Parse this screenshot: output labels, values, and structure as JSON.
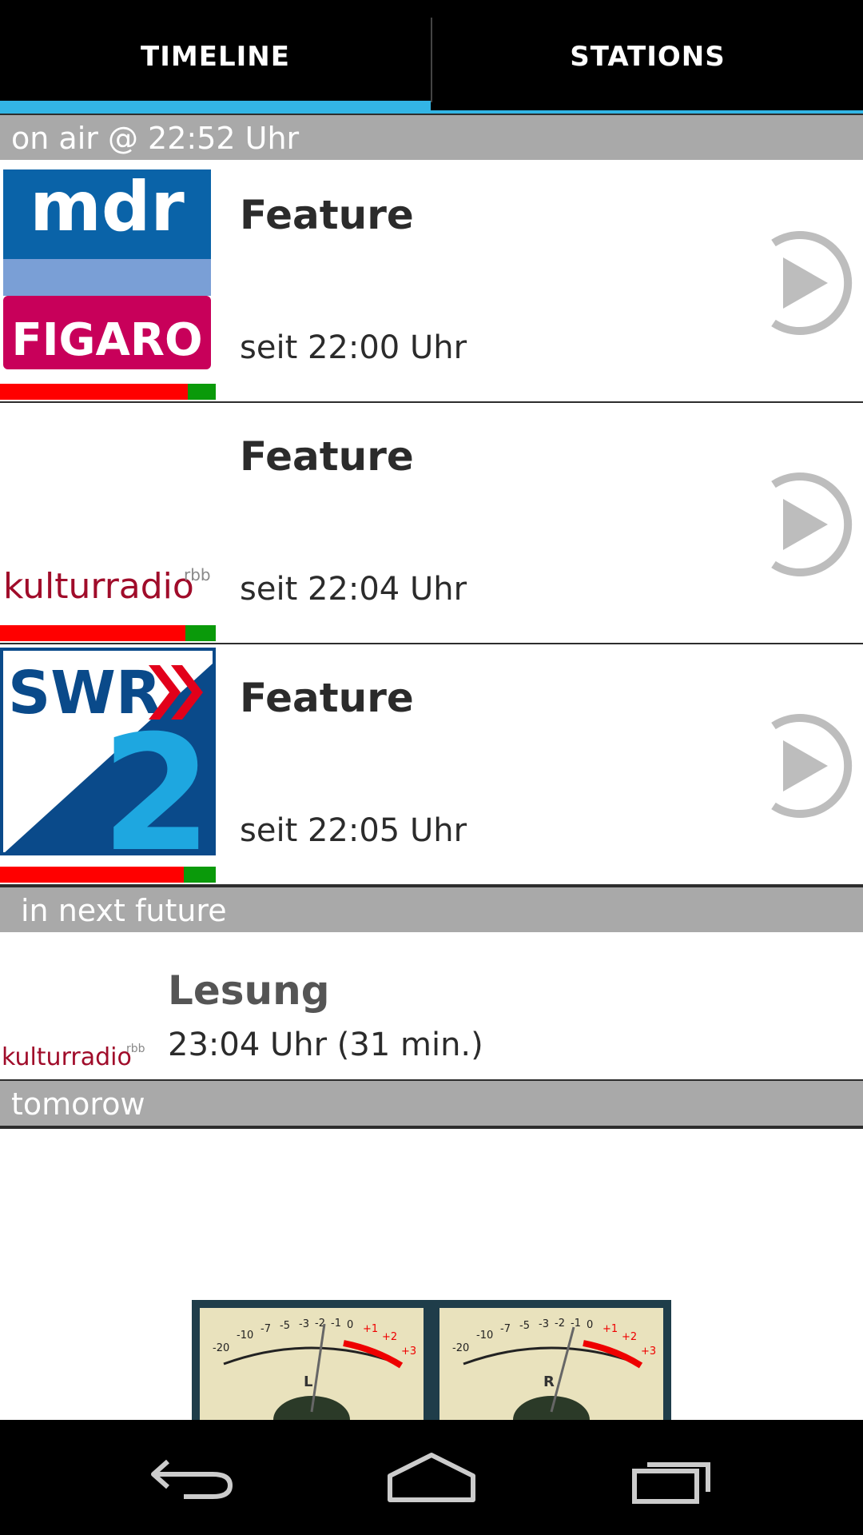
{
  "tabs": {
    "timeline": "TIMELINE",
    "stations": "STATIONS"
  },
  "sections": {
    "on_air": "on air @ 22:52 Uhr",
    "next_future": "in next future",
    "tomorrow": "tomorow"
  },
  "on_air_items": [
    {
      "station": "mdr FIGARO",
      "logo_top": "mdr",
      "logo_bottom": "FIGARO",
      "title": "Feature",
      "time": "seit 22:00 Uhr",
      "progress": 0.13
    },
    {
      "station": "kulturradio rbb",
      "logo_main": "kulturradio",
      "logo_sup": "rbb",
      "title": "Feature",
      "time": "seit 22:04 Uhr",
      "progress": 0.14
    },
    {
      "station": "SWR2",
      "logo_main": "SWR",
      "logo_num": "2",
      "title": "Feature",
      "time": "seit 22:05 Uhr",
      "progress": 0.15
    }
  ],
  "future_items": [
    {
      "station": "kulturradio rbb",
      "logo_main": "kulturradio",
      "logo_sup": "rbb",
      "title": "Lesung",
      "time": "23:04 Uhr (31 min.)"
    }
  ],
  "vu_meter": {
    "left_label": "L",
    "right_label": "R",
    "scale": [
      "-20",
      "-10",
      "-7",
      "-5",
      "-3",
      "-2",
      "-1",
      "0",
      "+1",
      "+2",
      "+3"
    ]
  },
  "colors": {
    "tab_accent": "#33b5e5",
    "section_bg": "#a9a9a9",
    "progress_remaining": "#ff0000",
    "progress_done": "#0a9a0a",
    "mdr_blue": "#0a63a8",
    "figaro_magenta": "#c8005a",
    "swr_blue": "#0a4a8a",
    "kultur_red": "#a00c2a"
  },
  "icons": {
    "play": "play-circle-icon",
    "back": "back-icon",
    "home": "home-icon",
    "recents": "recents-icon"
  }
}
